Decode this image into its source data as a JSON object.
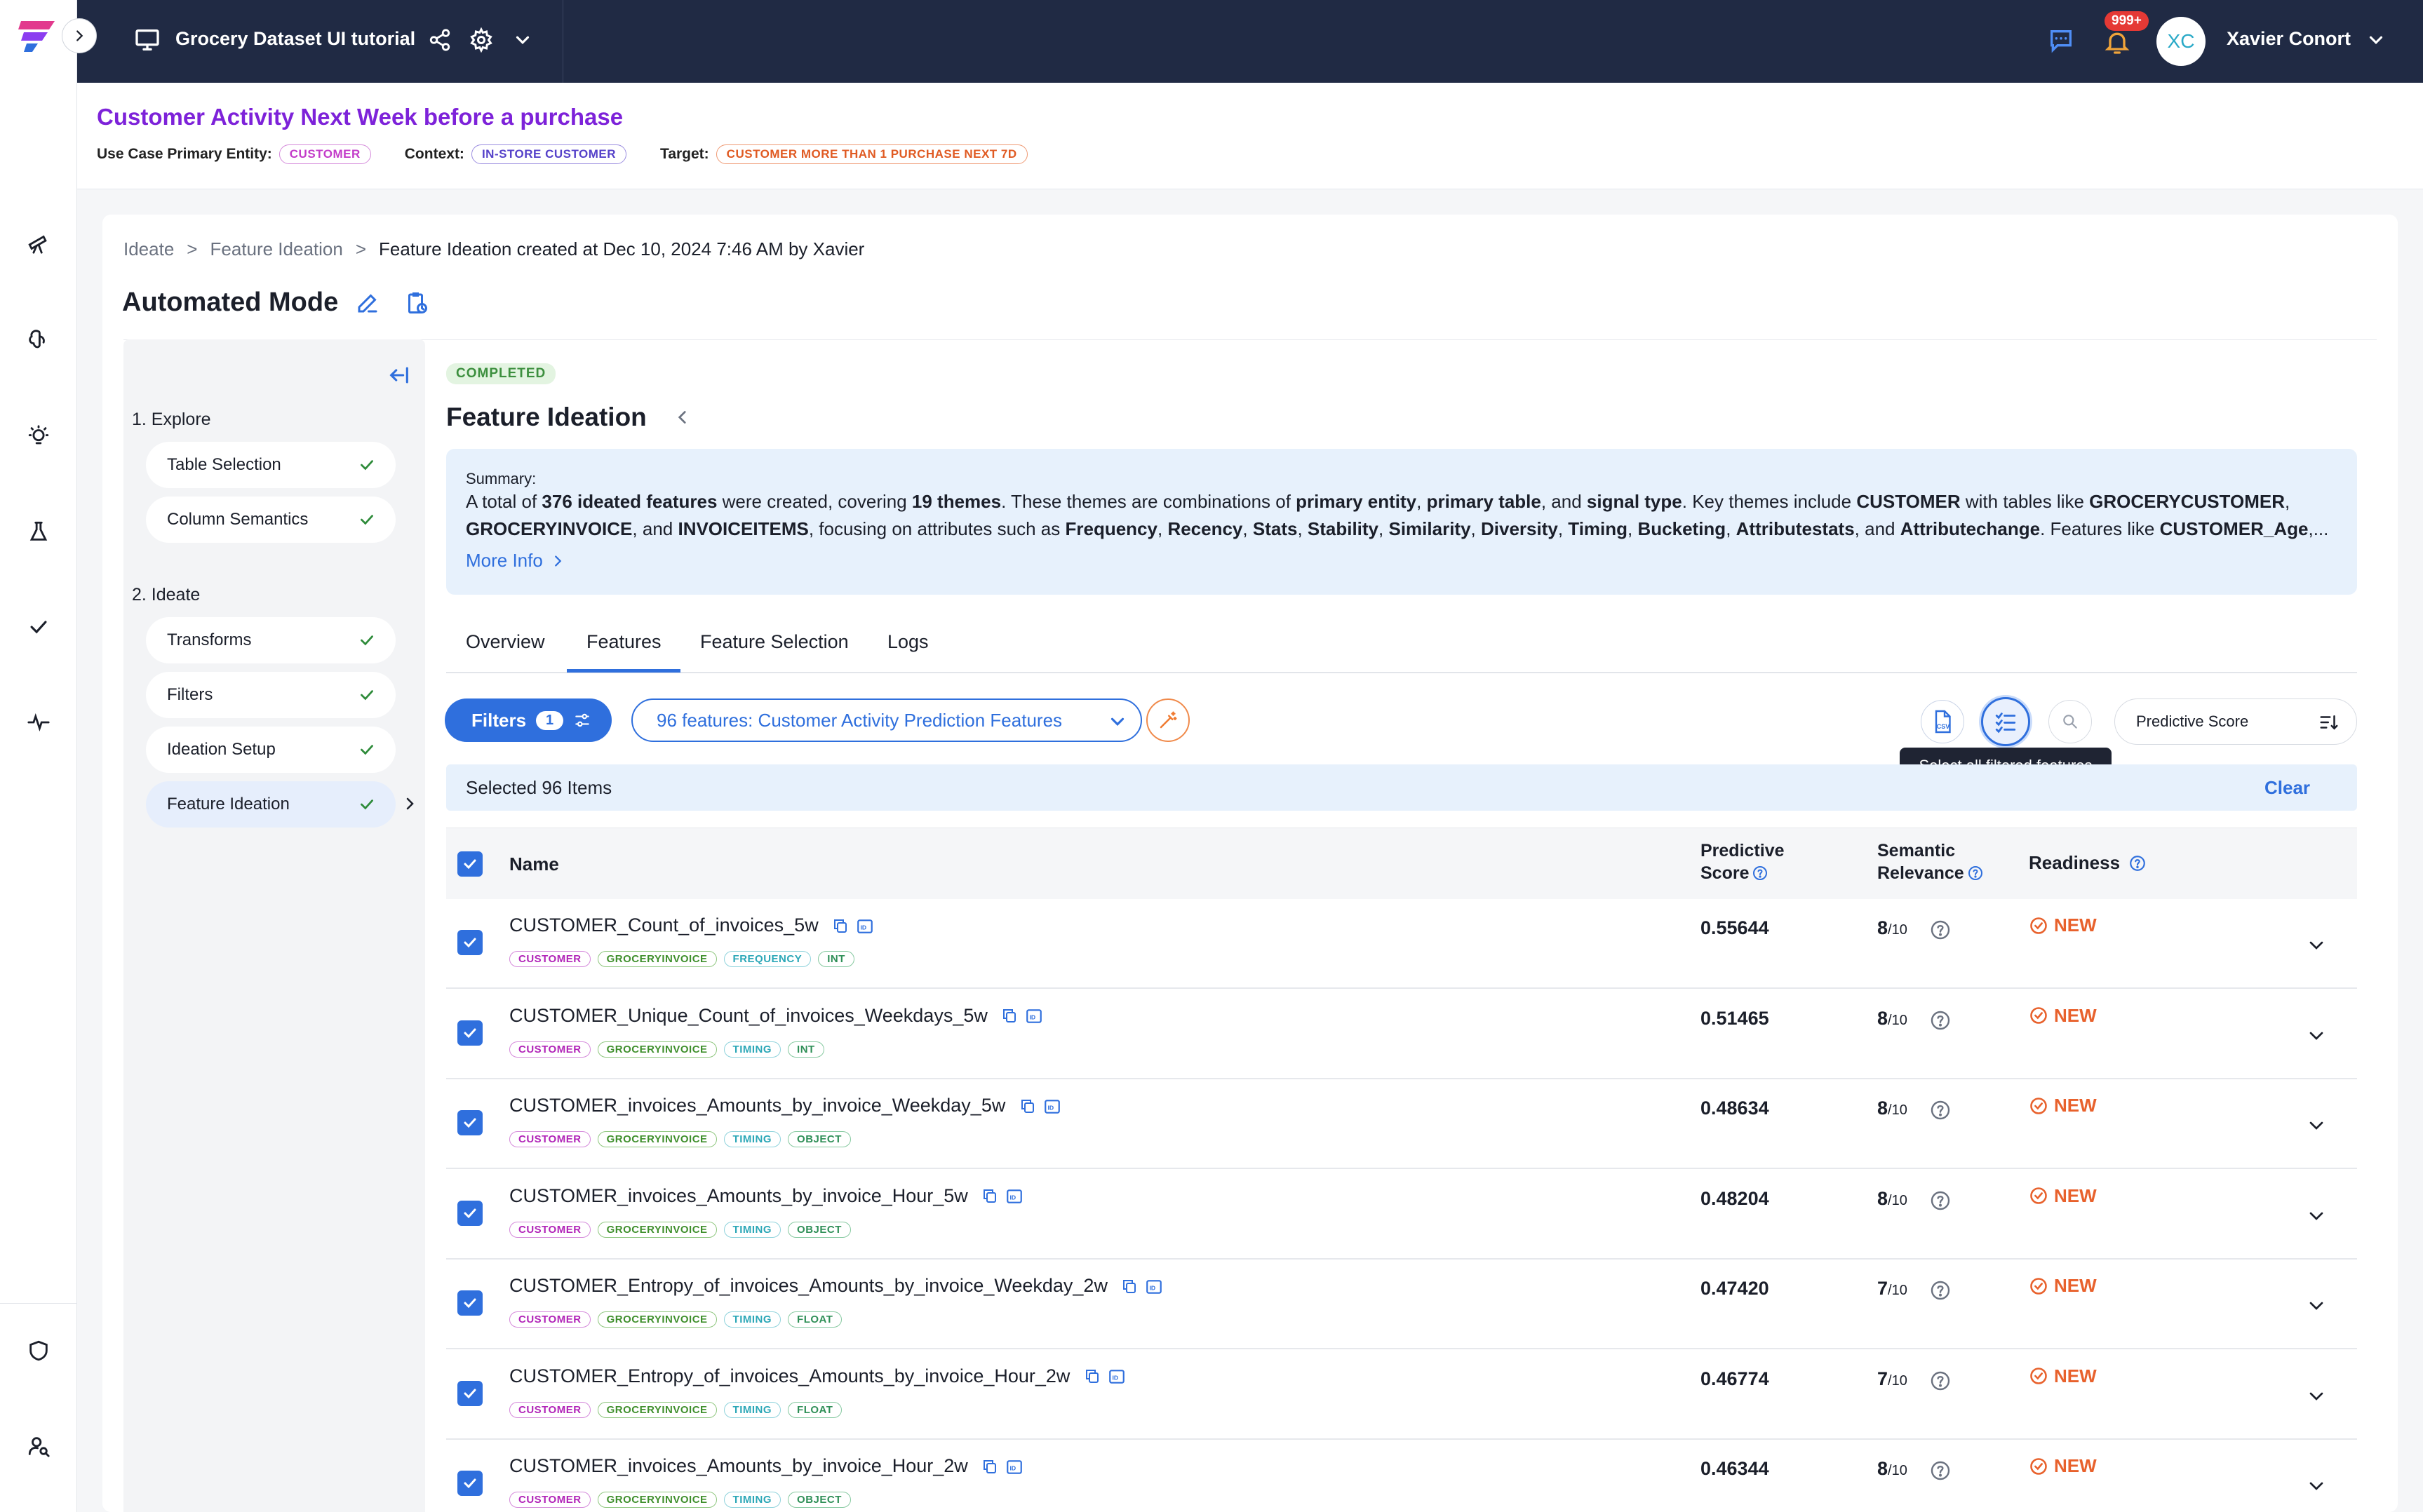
{
  "app": {
    "project_title": "Grocery Dataset UI tutorial",
    "notification_count": "999+",
    "user_initials": "XC",
    "user_name": "Xavier Conort"
  },
  "use_case": {
    "title": "Customer Activity Next Week before a purchase",
    "primary_entity_label": "Use Case Primary Entity:",
    "primary_entity": "CUSTOMER",
    "context_label": "Context:",
    "context": "IN-STORE CUSTOMER",
    "target_label": "Target:",
    "target": "CUSTOMER MORE THAN 1 PURCHASE NEXT 7D"
  },
  "breadcrumb": {
    "items": [
      "Ideate",
      "Feature Ideation"
    ],
    "current": "Feature Ideation created at Dec 10, 2024 7:46 AM by Xavier",
    "separator": ">"
  },
  "page": {
    "title": "Automated Mode"
  },
  "steps": {
    "groups": [
      {
        "label": "1. Explore",
        "items": [
          "Table Selection",
          "Column Semantics"
        ]
      },
      {
        "label": "2. Ideate",
        "items": [
          "Transforms",
          "Filters",
          "Ideation Setup",
          "Feature Ideation"
        ]
      }
    ]
  },
  "ideation": {
    "status": "COMPLETED",
    "title": "Feature Ideation",
    "summary_label": "Summary:",
    "summary_line1_parts": [
      {
        "t": "A total of ",
        "b": false
      },
      {
        "t": "376 ideated features",
        "b": true
      },
      {
        "t": " were created, covering ",
        "b": false
      },
      {
        "t": "19 themes",
        "b": true
      },
      {
        "t": ". These themes are combinations of ",
        "b": false
      },
      {
        "t": "primary entity",
        "b": true
      },
      {
        "t": ", ",
        "b": false
      },
      {
        "t": "primary table",
        "b": true
      },
      {
        "t": ", and ",
        "b": false
      },
      {
        "t": "signal type",
        "b": true
      },
      {
        "t": ". Key themes include ",
        "b": false
      },
      {
        "t": "CUSTOMER",
        "b": true
      },
      {
        "t": " with tables like ",
        "b": false
      },
      {
        "t": "GROCERYCUSTOMER",
        "b": true
      },
      {
        "t": ",",
        "b": false
      }
    ],
    "summary_line2_parts": [
      {
        "t": "GROCERYINVOICE",
        "b": true
      },
      {
        "t": ", and ",
        "b": false
      },
      {
        "t": "INVOICEITEMS",
        "b": true
      },
      {
        "t": ", focusing on attributes such as ",
        "b": false
      },
      {
        "t": "Frequency",
        "b": true
      },
      {
        "t": ", ",
        "b": false
      },
      {
        "t": "Recency",
        "b": true
      },
      {
        "t": ", ",
        "b": false
      },
      {
        "t": "Stats",
        "b": true
      },
      {
        "t": ", ",
        "b": false
      },
      {
        "t": "Stability",
        "b": true
      },
      {
        "t": ", ",
        "b": false
      },
      {
        "t": "Similarity",
        "b": true
      },
      {
        "t": ", ",
        "b": false
      },
      {
        "t": "Diversity",
        "b": true
      },
      {
        "t": ", ",
        "b": false
      },
      {
        "t": "Timing",
        "b": true
      },
      {
        "t": ", ",
        "b": false
      },
      {
        "t": "Bucketing",
        "b": true
      },
      {
        "t": ", ",
        "b": false
      },
      {
        "t": "Attributestats",
        "b": true
      },
      {
        "t": ", and ",
        "b": false
      },
      {
        "t": "Attributechange",
        "b": true
      },
      {
        "t": ". Features like ",
        "b": false
      },
      {
        "t": "CUSTOMER_Age",
        "b": true
      },
      {
        "t": ",...",
        "b": false
      }
    ],
    "more_info": "More Info"
  },
  "tabs": [
    {
      "label": "Overview",
      "active": false
    },
    {
      "label": "Features",
      "active": true
    },
    {
      "label": "Feature Selection",
      "active": false
    },
    {
      "label": "Logs",
      "active": false
    }
  ],
  "toolbar": {
    "filters_label": "Filters",
    "filters_count": "1",
    "feature_list_label": "96 features: Customer Activity Prediction Features",
    "sort_label": "Predictive Score",
    "tooltip": "Select all filtered features"
  },
  "selection": {
    "label": "Selected 96 Items",
    "clear": "Clear"
  },
  "table": {
    "headers": {
      "name": "Name",
      "predictive_score_l1": "Predictive",
      "predictive_score_l2": "Score",
      "semantic_relevance_l1": "Semantic",
      "semantic_relevance_l2": "Relevance",
      "readiness": "Readiness"
    },
    "rows": [
      {
        "name": "CUSTOMER_Count_of_invoices_5w",
        "tags": [
          "CUSTOMER",
          "GROCERYINVOICE",
          "FREQUENCY",
          "INT"
        ],
        "score": "0.55644",
        "relevance": "8",
        "relevance_den": "/10",
        "readiness": "NEW"
      },
      {
        "name": "CUSTOMER_Unique_Count_of_invoices_Weekdays_5w",
        "tags": [
          "CUSTOMER",
          "GROCERYINVOICE",
          "TIMING",
          "INT"
        ],
        "score": "0.51465",
        "relevance": "8",
        "relevance_den": "/10",
        "readiness": "NEW"
      },
      {
        "name": "CUSTOMER_invoices_Amounts_by_invoice_Weekday_5w",
        "tags": [
          "CUSTOMER",
          "GROCERYINVOICE",
          "TIMING",
          "OBJECT"
        ],
        "score": "0.48634",
        "relevance": "8",
        "relevance_den": "/10",
        "readiness": "NEW"
      },
      {
        "name": "CUSTOMER_invoices_Amounts_by_invoice_Hour_5w",
        "tags": [
          "CUSTOMER",
          "GROCERYINVOICE",
          "TIMING",
          "OBJECT"
        ],
        "score": "0.48204",
        "relevance": "8",
        "relevance_den": "/10",
        "readiness": "NEW"
      },
      {
        "name": "CUSTOMER_Entropy_of_invoices_Amounts_by_invoice_Weekday_2w",
        "tags": [
          "CUSTOMER",
          "GROCERYINVOICE",
          "TIMING",
          "FLOAT"
        ],
        "score": "0.47420",
        "relevance": "7",
        "relevance_den": "/10",
        "readiness": "NEW"
      },
      {
        "name": "CUSTOMER_Entropy_of_invoices_Amounts_by_invoice_Hour_2w",
        "tags": [
          "CUSTOMER",
          "GROCERYINVOICE",
          "TIMING",
          "FLOAT"
        ],
        "score": "0.46774",
        "relevance": "7",
        "relevance_den": "/10",
        "readiness": "NEW"
      },
      {
        "name": "CUSTOMER_invoices_Amounts_by_invoice_Hour_2w",
        "tags": [
          "CUSTOMER",
          "GROCERYINVOICE",
          "TIMING",
          "OBJECT"
        ],
        "score": "0.46344",
        "relevance": "8",
        "relevance_den": "/10",
        "readiness": "NEW"
      }
    ]
  },
  "icons": {
    "rail": [
      "telescope-icon",
      "brain-icon",
      "lightbulb-icon",
      "flask-icon",
      "check-icon",
      "pulse-icon",
      "shield-icon",
      "user-search-icon"
    ]
  },
  "colors": {
    "accent": "#2f6fdd",
    "title_purple": "#7d22d9",
    "topbar": "#202a44",
    "new_orange": "#e8612c"
  }
}
